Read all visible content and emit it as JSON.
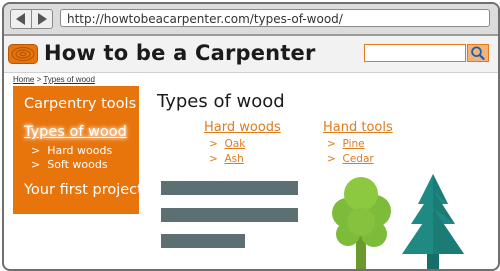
{
  "browser": {
    "url": "http://howtobeacarpenter.com/types-of-wood/"
  },
  "header": {
    "title": "How to be a Carpenter",
    "search_placeholder": ""
  },
  "breadcrumb": {
    "home": "Home",
    "separator": " > ",
    "current": "Types of wood"
  },
  "sidebar": {
    "items": [
      {
        "label": "Carpentry tools"
      },
      {
        "label": "Types of wood",
        "active": true
      },
      {
        "label": "Your first project"
      }
    ],
    "subitems": [
      {
        "label": "Hard woods"
      },
      {
        "label": "Soft woods"
      }
    ],
    "bullet": ">"
  },
  "main": {
    "heading": "Types of wood",
    "columns": [
      {
        "heading": "Hard woods",
        "items": [
          {
            "label": "Oak"
          },
          {
            "label": "Ash"
          }
        ]
      },
      {
        "heading": "Hand tools",
        "items": [
          {
            "label": "Pine"
          },
          {
            "label": "Cedar"
          }
        ]
      }
    ]
  },
  "colors": {
    "accent": "#e8740c",
    "link": "#e07b1b",
    "text_placeholder": "#5c6f73",
    "tree_green": "#7dbb3a",
    "pine_teal": "#1e8a82"
  },
  "icons": [
    "back-arrow-icon",
    "forward-arrow-icon",
    "logo-icon",
    "search-icon",
    "tree-icon",
    "pine-tree-icon"
  ]
}
